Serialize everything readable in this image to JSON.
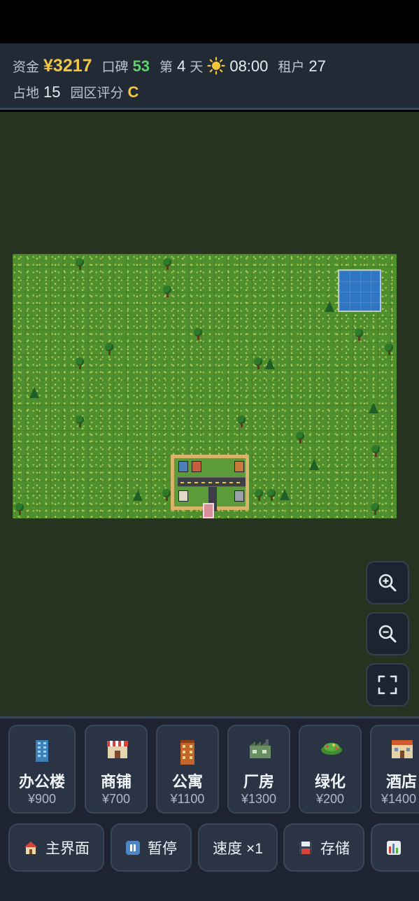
{
  "hud": {
    "funds_label": "资金",
    "funds_value": "¥3217",
    "reputation_label": "口碑",
    "reputation_value": "53",
    "day_prefix": "第",
    "day_value": "4",
    "day_suffix": "天",
    "weather_icon": "sun-icon",
    "time": "08:00",
    "tenants_label": "租户",
    "tenants_value": "27",
    "land_label": "占地",
    "land_value": "15",
    "rating_label": "园区评分",
    "rating_value": "C"
  },
  "map_controls": {
    "zoom_in_icon": "zoom-in-icon",
    "zoom_out_icon": "zoom-out-icon",
    "fullscreen_icon": "fullscreen-icon"
  },
  "build_menu": [
    {
      "name": "办公楼",
      "cost": "¥900",
      "icon": "office-building-icon"
    },
    {
      "name": "商铺",
      "cost": "¥700",
      "icon": "shop-icon"
    },
    {
      "name": "公寓",
      "cost": "¥1100",
      "icon": "apartment-icon"
    },
    {
      "name": "厂房",
      "cost": "¥1300",
      "icon": "factory-icon"
    },
    {
      "name": "绿化",
      "cost": "¥200",
      "icon": "greenery-icon"
    },
    {
      "name": "酒店",
      "cost": "¥1400",
      "icon": "hotel-icon"
    }
  ],
  "actions": {
    "main_menu": "主界面",
    "pause": "暂停",
    "speed": "速度 ×1",
    "save": "存储"
  },
  "colors": {
    "funds": "#f2c744",
    "reputation": "#5fd16d",
    "rating": "#f2c744",
    "grass": "#4f8f2e",
    "water": "#2f77c4",
    "background": "#263320"
  }
}
